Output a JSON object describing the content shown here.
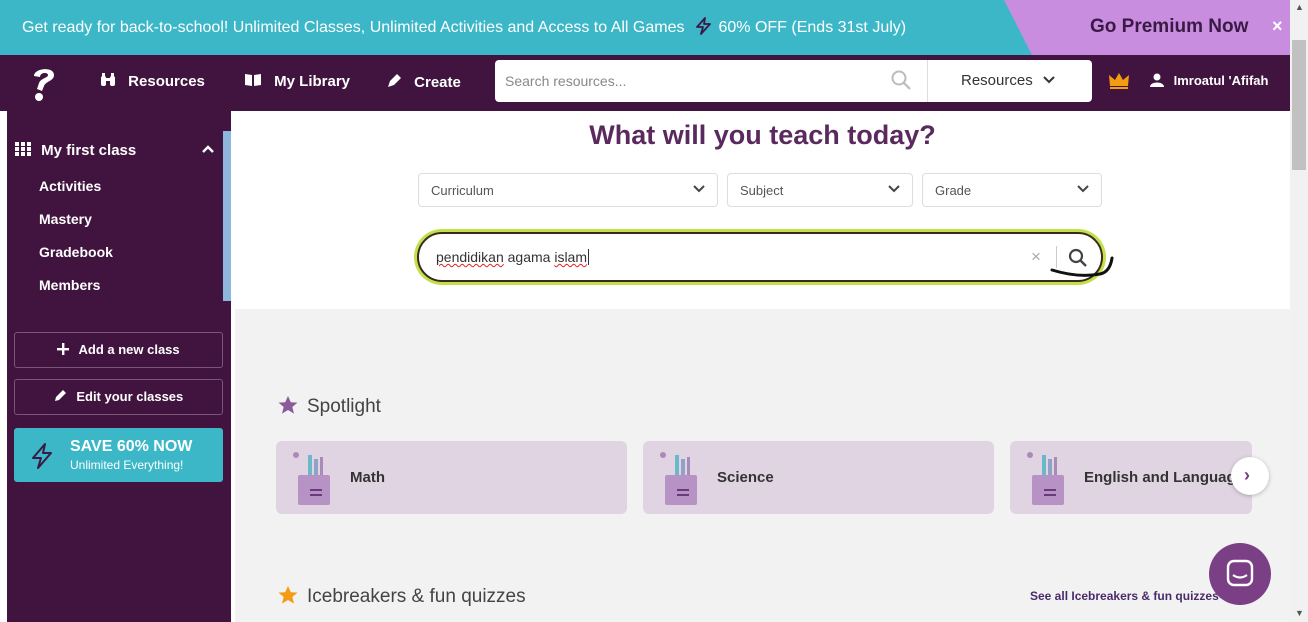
{
  "promo": {
    "text": "Get ready for back-to-school!  Unlimited Classes, Unlimited Activities and Access to All Games",
    "discount": "60% OFF (Ends 31st July)",
    "cta": "Go Premium Now",
    "close": "×"
  },
  "nav": {
    "resources": "Resources",
    "my_library": "My Library",
    "create": "Create",
    "search_placeholder": "Search resources...",
    "search_scope": "Resources",
    "user_name": "Imroatul 'Afifah"
  },
  "sidebar": {
    "class_title": "My first class",
    "items": [
      {
        "label": "Activities"
      },
      {
        "label": "Mastery"
      },
      {
        "label": "Gradebook"
      },
      {
        "label": "Members"
      }
    ],
    "add_class": "Add a new class",
    "edit_classes": "Edit your classes",
    "save_title": "SAVE 60% NOW",
    "save_sub": "Unlimited Everything!"
  },
  "main": {
    "hero_title": "What will you teach today?",
    "filters": [
      {
        "label": "Curriculum"
      },
      {
        "label": "Subject"
      },
      {
        "label": "Grade"
      }
    ],
    "search_words": [
      "pendidikan",
      "agama",
      "islam"
    ],
    "spotlight_title": "Spotlight",
    "spotlight_cards": [
      {
        "label": "Math"
      },
      {
        "label": "Science"
      },
      {
        "label": "English and Language"
      }
    ],
    "icebreakers_title": "Icebreakers & fun quizzes",
    "see_all": "See all Icebreakers & fun quizzes"
  },
  "colors": {
    "brand_purple": "#40143e",
    "promo_teal": "#3bb7c8",
    "cta_pink": "#c98de0",
    "hero_title": "#5a2a5e",
    "search_focus": "#c2e04a",
    "spotlight_star": "#8a5a9a",
    "icebreaker_star": "#f39c12"
  },
  "icons": [
    "logo-icon",
    "binoculars-icon",
    "book-icon",
    "pen-icon",
    "search-icon",
    "chevron-down-icon",
    "crown-icon",
    "user-icon",
    "grid-icon",
    "chevron-up-icon",
    "plus-icon",
    "pencil-icon",
    "bolt-icon",
    "close-icon",
    "star-icon",
    "chevron-right-icon",
    "chat-icon"
  ]
}
